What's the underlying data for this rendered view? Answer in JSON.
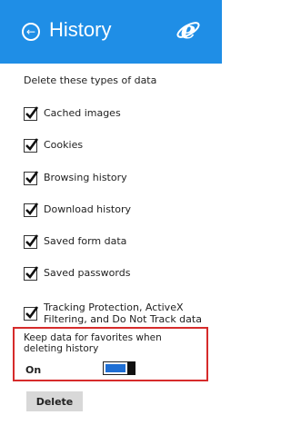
{
  "header": {
    "title": "History",
    "back_icon": "back-arrow-circle-icon",
    "logo_icon": "internet-explorer-logo-icon",
    "background": "#1f8ee6"
  },
  "intro": "Delete these types of data",
  "options": [
    {
      "label": "Cached images",
      "checked": true
    },
    {
      "label": "Cookies",
      "checked": true
    },
    {
      "label": "Browsing history",
      "checked": true
    },
    {
      "label": "Download history",
      "checked": true
    },
    {
      "label": "Saved form data",
      "checked": true
    },
    {
      "label": "Saved passwords",
      "checked": true
    },
    {
      "label": "Tracking Protection, ActiveX Filtering, and Do Not Track data",
      "checked": true
    }
  ],
  "keep_favorites": {
    "label": "Keep data for favorites when deleting history",
    "state_label": "On",
    "highlight_color": "#d62b2b"
  },
  "delete_label": "Delete"
}
